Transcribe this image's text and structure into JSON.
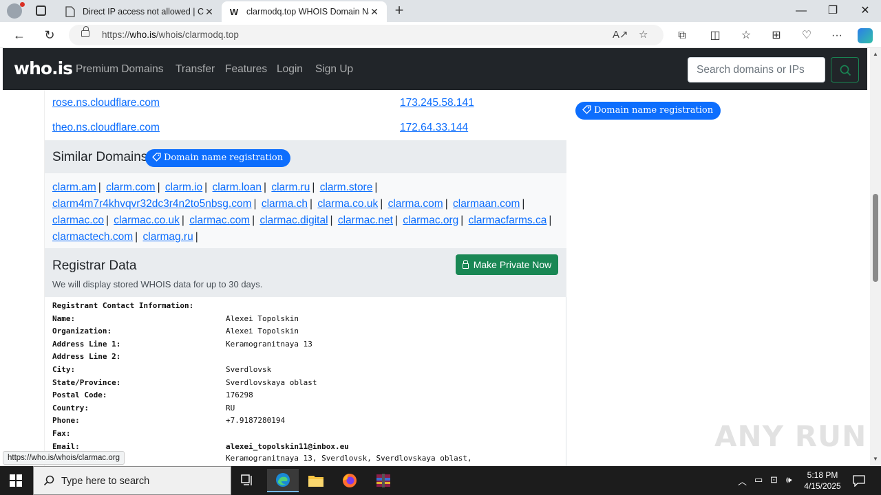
{
  "browser": {
    "tabs": [
      {
        "title": "Direct IP access not allowed | Clo",
        "active": false
      },
      {
        "title": "clarmodq.top WHOIS Domain Na",
        "active": true
      }
    ],
    "url_prefix": "https://",
    "url_host": "who.is",
    "url_path": "/whois/clarmodq.top",
    "status_url": "https://who.is/whois/clarmac.org"
  },
  "site": {
    "logo": "who.is",
    "nav": [
      "Premium Domains",
      "Transfer",
      "Features",
      "Login",
      "Sign Up"
    ],
    "search_placeholder": "Search domains or IPs"
  },
  "nameservers": [
    {
      "name": "rose.ns.cloudflare.com",
      "ip": "173.245.58.141"
    },
    {
      "name": "theo.ns.cloudflare.com",
      "ip": "172.64.33.144"
    }
  ],
  "similar": {
    "title": "Similar Domains",
    "badge": "Domain name registration",
    "domains": [
      "clarm.am",
      "clarm.com",
      "clarm.io",
      "clarm.loan",
      "clarm.ru",
      "clarm.store",
      "clarm4m7r4khvqvr32dc3r4n2to5nbsg.com",
      "clarma.ch",
      "clarma.co.uk",
      "clarma.com",
      "clarmaan.com",
      "clarmac.co",
      "clarmac.co.uk",
      "clarmac.com",
      "clarmac.digital",
      "clarmac.net",
      "clarmac.org",
      "clarmacfarms.ca",
      "clarmactech.com",
      "clarmag.ru"
    ]
  },
  "registrar": {
    "title": "Registrar Data",
    "subtitle": "We will display stored WHOIS data for up to 30 days.",
    "private_button": "Make Private Now",
    "section_heading": "Registrant Contact Information:",
    "rows": [
      {
        "k": "Name:",
        "v": "Alexei Topolskin"
      },
      {
        "k": "Organization:",
        "v": "Alexei Topolskin"
      },
      {
        "k": "Address Line 1:",
        "v": "Keramogranitnaya 13"
      },
      {
        "k": "Address Line 2:",
        "v": ""
      },
      {
        "k": "City:",
        "v": "Sverdlovsk"
      },
      {
        "k": "State/Province:",
        "v": "Sverdlovskaya oblast"
      },
      {
        "k": "Postal Code:",
        "v": "176298"
      },
      {
        "k": "Country:",
        "v": "RU"
      },
      {
        "k": "Phone:",
        "v": "+7.9187280194"
      },
      {
        "k": "Fax:",
        "v": ""
      },
      {
        "k": "Email:",
        "v": "alexei_topolskin11@inbox.eu",
        "bold": true
      },
      {
        "k": "",
        "v": "Keramogranitnaya 13, Sverdlovsk, Sverdlovskaya oblast,"
      }
    ]
  },
  "sidebar": {
    "badge": "Domain name registration"
  },
  "watermark": "ANY RUN",
  "taskbar": {
    "search_placeholder": "Type here to search",
    "time": "5:18 PM",
    "date": "4/15/2025"
  },
  "colors": {
    "link": "#0d6efd",
    "nav_bg": "#212529",
    "success": "#198754"
  }
}
